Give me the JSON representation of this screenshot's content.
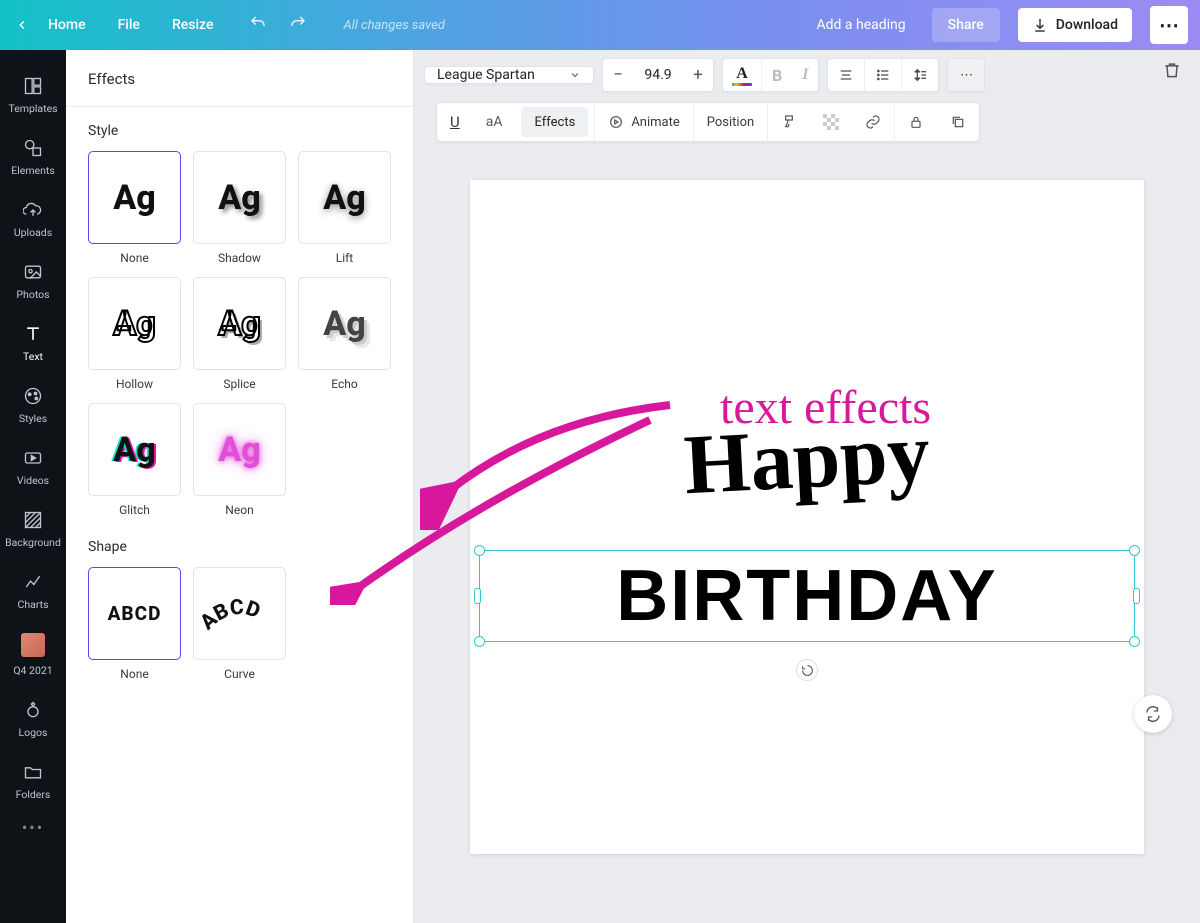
{
  "topbar": {
    "home": "Home",
    "file": "File",
    "resize": "Resize",
    "saved": "All changes saved",
    "add_heading": "Add a heading",
    "share": "Share",
    "download": "Download"
  },
  "rail": {
    "templates": "Templates",
    "elements": "Elements",
    "uploads": "Uploads",
    "photos": "Photos",
    "text": "Text",
    "styles": "Styles",
    "videos": "Videos",
    "background": "Background",
    "charts": "Charts",
    "q4": "Q4 2021",
    "logos": "Logos",
    "folders": "Folders"
  },
  "panel": {
    "title": "Effects",
    "style_title": "Style",
    "shape_title": "Shape",
    "styles": {
      "none": "None",
      "shadow": "Shadow",
      "lift": "Lift",
      "hollow": "Hollow",
      "splice": "Splice",
      "echo": "Echo",
      "glitch": "Glitch",
      "neon": "Neon"
    },
    "shapes": {
      "none": "None",
      "curve": "Curve"
    },
    "sample": "Ag",
    "shape_sample": "ABCD"
  },
  "toolbar": {
    "font": "League Spartan",
    "size": "94.9",
    "effects": "Effects",
    "animate": "Animate",
    "position": "Position",
    "aA": "aA",
    "U": "U"
  },
  "canvas": {
    "annotation": "text effects",
    "happy": "Happy",
    "birthday": "BIRTHDAY"
  }
}
